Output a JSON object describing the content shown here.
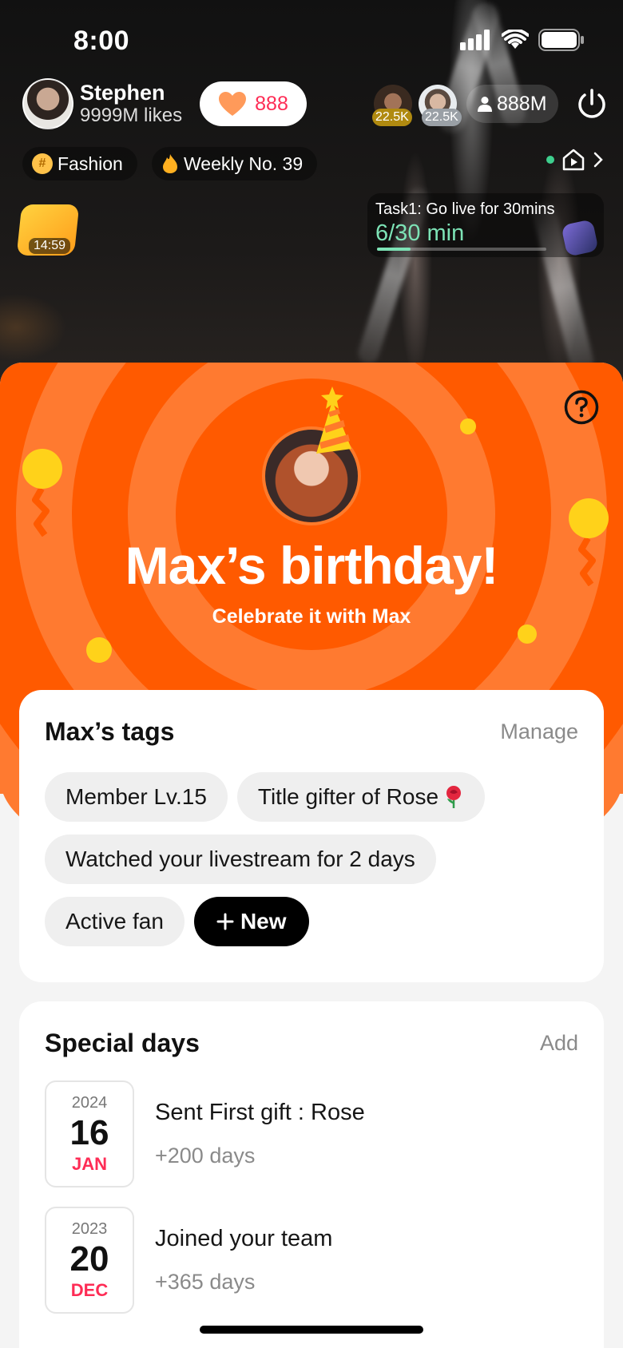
{
  "status_bar": {
    "time": "8:00"
  },
  "live_header": {
    "host_name": "Stephen",
    "host_likes": "9999M likes",
    "like_count": "888",
    "viewers": [
      {
        "badge": "22.5K"
      },
      {
        "badge": "22.5K"
      }
    ],
    "viewer_count": "888M",
    "chips": {
      "fashion": "Fashion",
      "weekly": "Weekly No. 39"
    },
    "promo_timer": "14:59",
    "task": {
      "title": "Task1: Go live for 30mins",
      "progress_text": "6/30 min",
      "progress": 0.2
    }
  },
  "banner": {
    "title": "Max’s birthday!",
    "subtitle": "Celebrate it with Max",
    "colors": {
      "bg": "#ff5a00",
      "ring": "#ff7a30",
      "confetti": "#ffd21a"
    }
  },
  "tags_card": {
    "title": "Max’s tags",
    "action": "Manage",
    "tags": [
      "Member Lv.15",
      "Title gifter of Rose",
      "Watched your livestream for 2 days",
      "Active fan"
    ],
    "new_label": "New"
  },
  "special_days": {
    "title": "Special days",
    "action": "Add",
    "items": [
      {
        "year": "2024",
        "day": "16",
        "month": "JAN",
        "title": "Sent First gift : Rose",
        "sub": "+200 days"
      },
      {
        "year": "2023",
        "day": "20",
        "month": "DEC",
        "title": "Joined your team",
        "sub": "+365 days"
      }
    ]
  }
}
